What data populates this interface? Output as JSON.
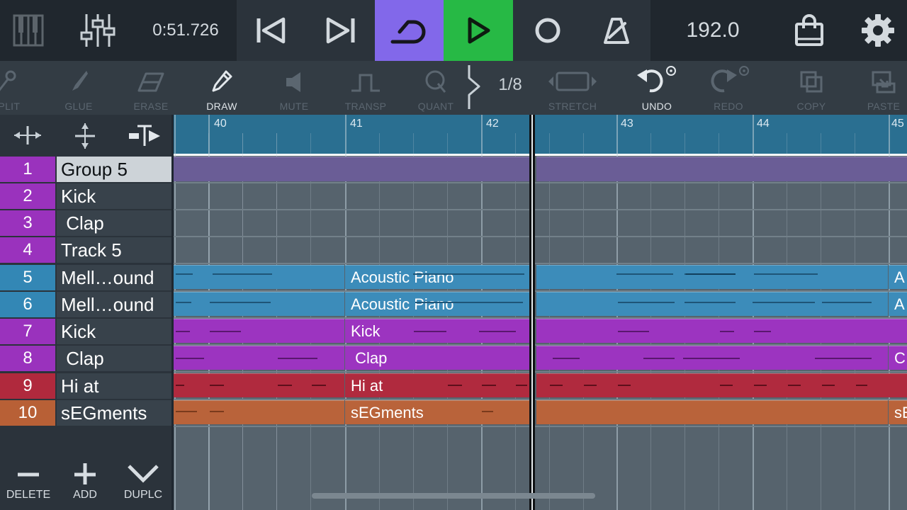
{
  "transport": {
    "time": "0:51.726",
    "tempo": "192.0",
    "colors": {
      "loop_active": "#8268ea",
      "play_active": "#27b945"
    },
    "icons": [
      "piano-keys-icon",
      "mixer-icon",
      "skip-to-start-icon",
      "skip-to-end-icon",
      "loop-icon",
      "play-icon",
      "record-icon",
      "metronome-icon",
      "shop-bag-icon",
      "settings-gear-icon"
    ]
  },
  "toolbar": {
    "split_label": "SPLIT",
    "glue_label": "GLUE",
    "erase_label": "ERASE",
    "draw_label": "DRAW",
    "mute_label": "MUTE",
    "transp_label": "TRANSP",
    "quant_label": "QUANT",
    "quant_value": "1/8",
    "stretch_label": "STRETCH",
    "undo_label": "UNDO",
    "redo_label": "REDO",
    "copy_label": "COPY",
    "paste_label": "PASTE"
  },
  "ruler": {
    "bars": [
      "40",
      "41",
      "42",
      "43",
      "44",
      "45"
    ]
  },
  "tracks": [
    {
      "num": "1",
      "name": "Group 5",
      "color": "#9a32bd"
    },
    {
      "num": "2",
      "name": "Kick",
      "color": "#9a32bd"
    },
    {
      "num": "3",
      "name": " Clap",
      "color": "#9a32bd"
    },
    {
      "num": "4",
      "name": "Track 5",
      "color": "#9a32bd"
    },
    {
      "num": "5",
      "name": "Mell…ound",
      "color": "#3387b5"
    },
    {
      "num": "6",
      "name": "Mell…ound",
      "color": "#3387b5"
    },
    {
      "num": "7",
      "name": "Kick",
      "color": "#9a32bd"
    },
    {
      "num": "8",
      "name": " Clap",
      "color": "#9a32bd"
    },
    {
      "num": "9",
      "name": "Hi at",
      "color": "#b0293d"
    },
    {
      "num": "10",
      "name": "sEGments",
      "color": "#b86036"
    }
  ],
  "clips": {
    "piano_1": "Acoustic Piano",
    "piano_2": "Acoustic Piano",
    "piano_cut_1": "A",
    "piano_cut_2": "A",
    "kick": "Kick",
    "clap": " Clap",
    "clap_cut": "C",
    "hihat": "Hi at",
    "segments": "sEGments",
    "segments_cut": "sE"
  },
  "bottom_buttons": {
    "delete_label": "DELETE",
    "add_label": "ADD",
    "duplicate_label": "DUPLC"
  }
}
